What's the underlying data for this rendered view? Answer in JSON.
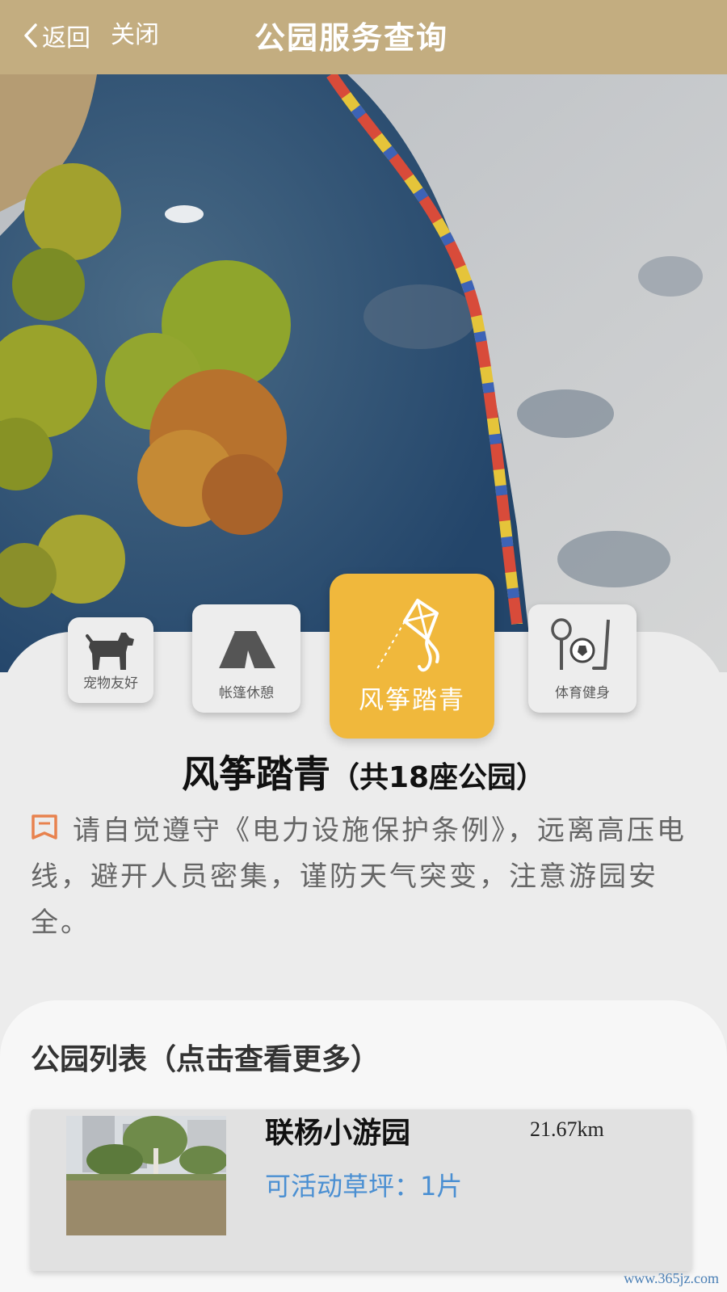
{
  "navbar": {
    "back_label": "返回",
    "close_label": "关闭",
    "title": "公园服务查询",
    "background_color": "#c3ad80"
  },
  "categories": [
    {
      "label": "宠物友好",
      "icon": "dog-icon",
      "selected": false
    },
    {
      "label": "帐篷休憩",
      "icon": "tent-icon",
      "selected": false
    },
    {
      "label": "风筝踏青",
      "icon": "kite-icon",
      "selected": true
    },
    {
      "label": "体育健身",
      "icon": "sports-icon",
      "selected": false
    }
  ],
  "section": {
    "title": "风筝踏青",
    "count_text": "（共18座公园）"
  },
  "notice": {
    "icon": "bookmark-icon",
    "text": "请自觉遵守《电力设施保护条例》，远离高压电线，避开人员密集，谨防天气突变，注意游园安全。"
  },
  "park_list": {
    "title": "公园列表（点击查看更多）",
    "items": [
      {
        "name": "联杨小游园",
        "distance": "21.67km",
        "lawn_text": "可活动草坪：1片"
      }
    ]
  },
  "watermark": "www.365jz.com",
  "colors": {
    "accent_selected": "#f0b83c",
    "link_blue": "#4a8fd2",
    "notice_icon": "#e8824e"
  }
}
